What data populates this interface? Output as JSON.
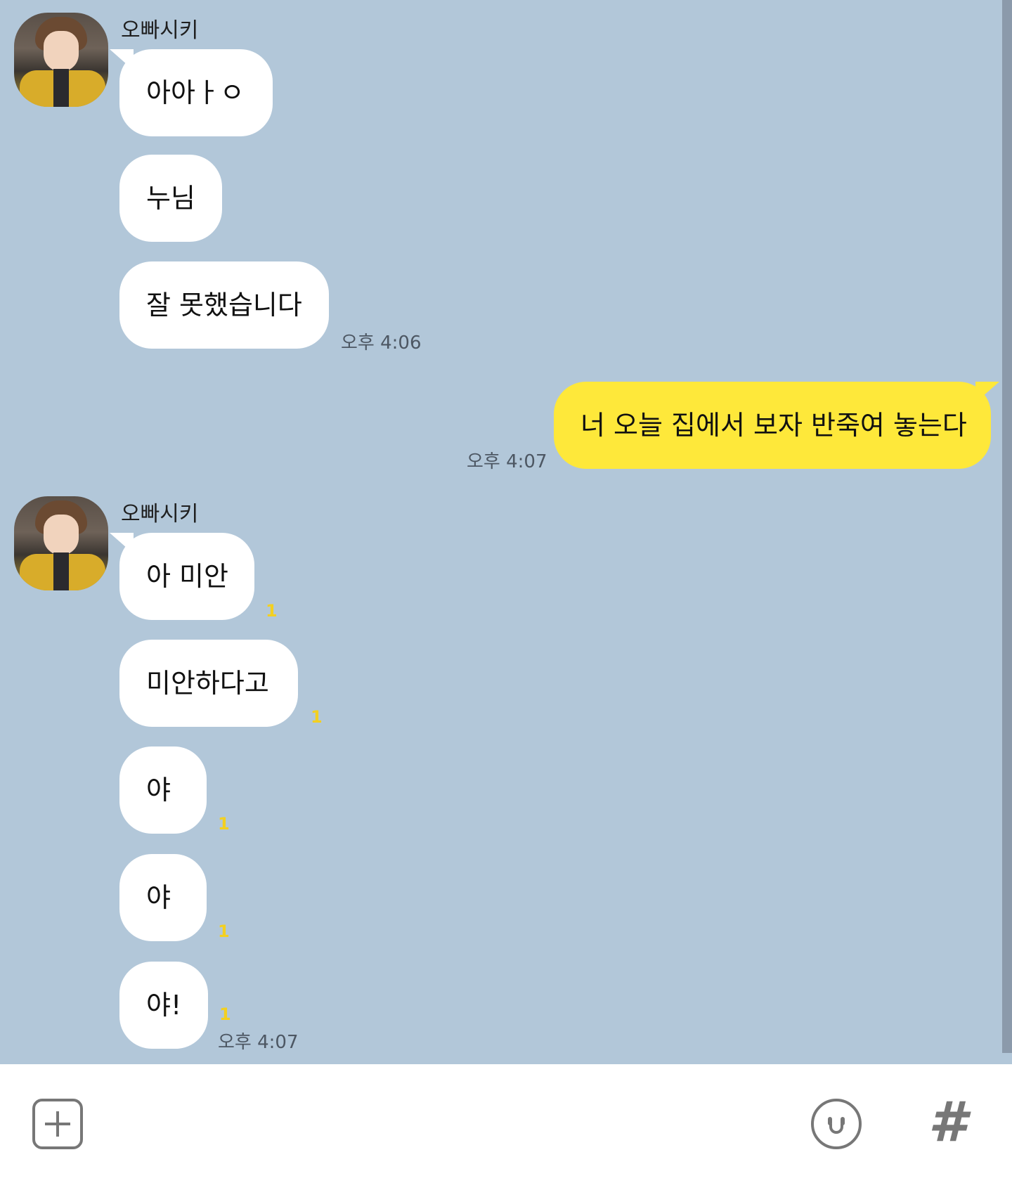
{
  "contact": {
    "name": "오빠시키"
  },
  "messages": [
    {
      "text": "아아ㅏㅇ"
    },
    {
      "text": "누님"
    },
    {
      "text": "잘 못했습니다",
      "time": "오후 4:06"
    },
    {
      "text": "너 오늘 집에서 보자 반죽여 놓는다",
      "time": "오후 4:07",
      "mine": true
    },
    {
      "text": "아 미안",
      "unread": "1"
    },
    {
      "text": "미안하다고",
      "unread": "1"
    },
    {
      "text": "야",
      "unread": "1"
    },
    {
      "text": "야",
      "unread": "1"
    },
    {
      "text": "야!",
      "unread": "1",
      "time": "오후 4:07"
    }
  ],
  "input_bar": {
    "plus_icon": "plus-square-icon",
    "emoji_icon": "smiley-icon",
    "hash_icon": "hashtag-icon",
    "hash_label": "#"
  },
  "colors": {
    "chat_background": "#b2c7d9",
    "their_bubble": "#ffffff",
    "my_bubble": "#fee83a",
    "unread_count": "#f3d020"
  }
}
